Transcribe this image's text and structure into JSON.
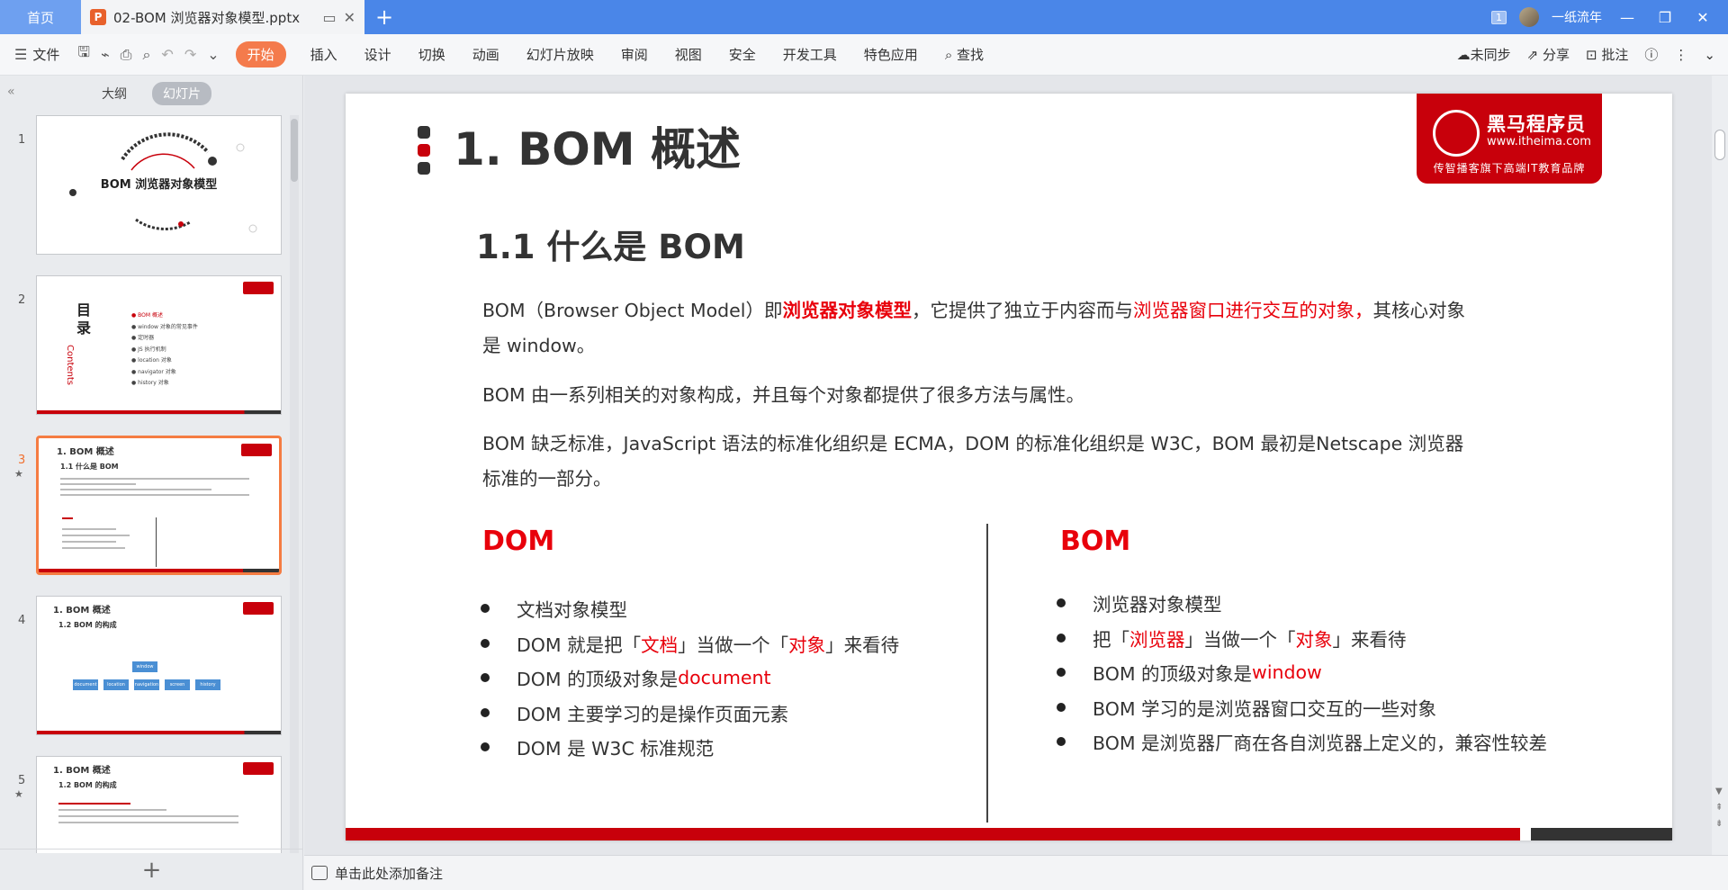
{
  "titlebar": {
    "home_tab": "首页",
    "doc_tab": "02-BOM 浏览器对象模型.pptx",
    "doc_icon": "P",
    "add_tab": "+",
    "badge": "1",
    "user": "一纸流年"
  },
  "menubar": {
    "file": "文件",
    "items": [
      "开始",
      "插入",
      "设计",
      "切换",
      "动画",
      "幻灯片放映",
      "审阅",
      "视图",
      "安全",
      "开发工具",
      "特色应用"
    ],
    "search": "查找",
    "sync": "未同步",
    "share": "分享",
    "annotate": "批注"
  },
  "leftpane": {
    "tab_outline": "大纲",
    "tab_slides": "幻灯片",
    "thumbs": [
      {
        "num": "1",
        "title": "BOM 浏览器对象模型"
      },
      {
        "num": "2",
        "title": "目录",
        "contents": "Contents",
        "items": [
          "BOM 概述",
          "window 对象的常见事件",
          "定时器",
          "JS 执行机制",
          "location 对象",
          "navigator 对象",
          "history 对象"
        ]
      },
      {
        "num": "3",
        "title": "1. BOM 概述",
        "sub": "1.1 什么是 BOM",
        "star": "★"
      },
      {
        "num": "4",
        "title": "1. BOM 概述",
        "sub": "1.2 BOM 的构成",
        "boxes": [
          "document",
          "location",
          "navigation",
          "screen",
          "history"
        ],
        "root": "window"
      },
      {
        "num": "5",
        "title": "1. BOM 概述",
        "sub": "1.2 BOM 的构成",
        "star": "★"
      }
    ],
    "add": "+"
  },
  "slide": {
    "title": "1. BOM 概述",
    "logo": {
      "name": "黑马程序员",
      "url": "www.itheima.com",
      "tagline": "传智播客旗下高端IT教育品牌"
    },
    "subtitle": "1.1 什么是 BOM",
    "p1_a": "BOM（Browser Object Model）即",
    "p1_b": "浏览器对象模型",
    "p1_c": "，它提供了独立于内容而与",
    "p1_d": "浏览器窗口进行交互的对象，",
    "p1_e": "其核心对象是 window。",
    "p2": "BOM 由一系列相关的对象构成，并且每个对象都提供了很多方法与属性。",
    "p3": "BOM 缺乏标准，JavaScript 语法的标准化组织是 ECMA，DOM 的标准化组织是 W3C，BOM 最初是Netscape 浏览器标准的一部分。",
    "dom_heading": "DOM",
    "dom_items": {
      "i1": "文档对象模型",
      "i2_a": "DOM 就是把「",
      "i2_b": "文档",
      "i2_c": "」当做一个「",
      "i2_d": "对象",
      "i2_e": "」来看待",
      "i3_a": "DOM 的顶级对象是 ",
      "i3_b": "document",
      "i4": "DOM 主要学习的是操作页面元素",
      "i5": "DOM 是 W3C 标准规范"
    },
    "bom_heading": "BOM",
    "bom_items": {
      "i1": "浏览器对象模型",
      "i2_a": "把「",
      "i2_b": "浏览器",
      "i2_c": "」当做一个「",
      "i2_d": "对象",
      "i2_e": "」来看待",
      "i3_a": "BOM 的顶级对象是 ",
      "i3_b": "window",
      "i4": "BOM 学习的是浏览器窗口交互的一些对象",
      "i5": "BOM 是浏览器厂商在各自浏览器上定义的，兼容性较差"
    }
  },
  "notes": {
    "placeholder": "单击此处添加备注"
  },
  "colors": {
    "brand_red": "#c8000b",
    "accent_orange": "#f47b4c",
    "titlebar_blue": "#4a86e8"
  }
}
